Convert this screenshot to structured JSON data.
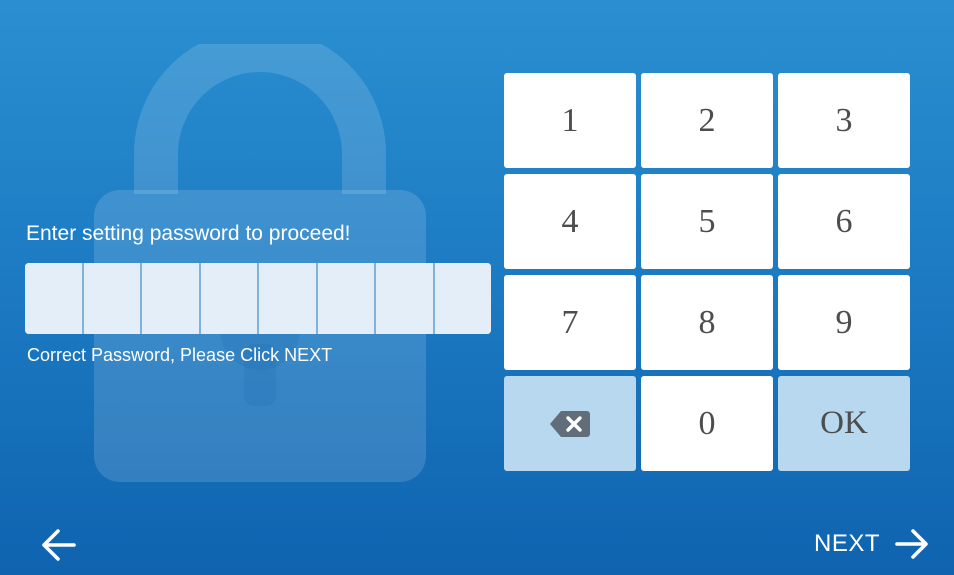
{
  "prompt": "Enter setting password to proceed!",
  "status": "Correct Password, Please Click NEXT",
  "password_cells": 8,
  "keypad": {
    "keys": [
      "1",
      "2",
      "3",
      "4",
      "5",
      "6",
      "7",
      "8",
      "9",
      "",
      "0",
      "OK"
    ],
    "backspace_icon": "backspace-icon"
  },
  "nav": {
    "back_icon": "arrow-left-icon",
    "next_label": "NEXT",
    "next_icon": "arrow-right-icon"
  },
  "colors": {
    "bg_top": "#2a8fd0",
    "bg_bottom": "#0f63af",
    "key": "#ffffff",
    "key_alt": "#b8d8ef",
    "key_text": "#4d4d4d"
  }
}
